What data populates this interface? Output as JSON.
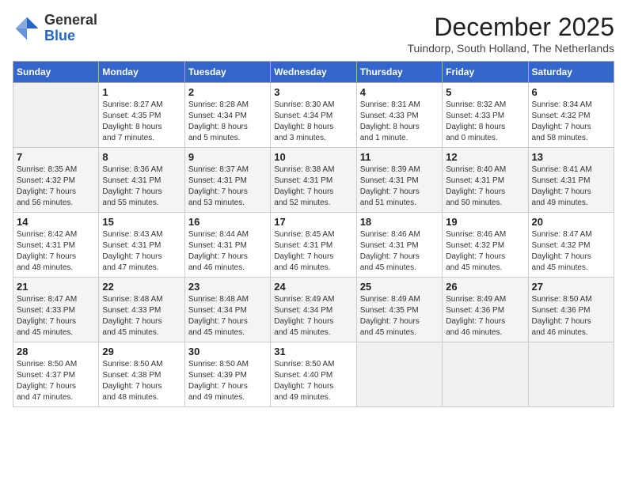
{
  "header": {
    "logo_general": "General",
    "logo_blue": "Blue",
    "month_year": "December 2025",
    "location": "Tuindorp, South Holland, The Netherlands"
  },
  "weekdays": [
    "Sunday",
    "Monday",
    "Tuesday",
    "Wednesday",
    "Thursday",
    "Friday",
    "Saturday"
  ],
  "weeks": [
    [
      {
        "day": "",
        "info": ""
      },
      {
        "day": "1",
        "info": "Sunrise: 8:27 AM\nSunset: 4:35 PM\nDaylight: 8 hours\nand 7 minutes."
      },
      {
        "day": "2",
        "info": "Sunrise: 8:28 AM\nSunset: 4:34 PM\nDaylight: 8 hours\nand 5 minutes."
      },
      {
        "day": "3",
        "info": "Sunrise: 8:30 AM\nSunset: 4:34 PM\nDaylight: 8 hours\nand 3 minutes."
      },
      {
        "day": "4",
        "info": "Sunrise: 8:31 AM\nSunset: 4:33 PM\nDaylight: 8 hours\nand 1 minute."
      },
      {
        "day": "5",
        "info": "Sunrise: 8:32 AM\nSunset: 4:33 PM\nDaylight: 8 hours\nand 0 minutes."
      },
      {
        "day": "6",
        "info": "Sunrise: 8:34 AM\nSunset: 4:32 PM\nDaylight: 7 hours\nand 58 minutes."
      }
    ],
    [
      {
        "day": "7",
        "info": "Sunrise: 8:35 AM\nSunset: 4:32 PM\nDaylight: 7 hours\nand 56 minutes."
      },
      {
        "day": "8",
        "info": "Sunrise: 8:36 AM\nSunset: 4:31 PM\nDaylight: 7 hours\nand 55 minutes."
      },
      {
        "day": "9",
        "info": "Sunrise: 8:37 AM\nSunset: 4:31 PM\nDaylight: 7 hours\nand 53 minutes."
      },
      {
        "day": "10",
        "info": "Sunrise: 8:38 AM\nSunset: 4:31 PM\nDaylight: 7 hours\nand 52 minutes."
      },
      {
        "day": "11",
        "info": "Sunrise: 8:39 AM\nSunset: 4:31 PM\nDaylight: 7 hours\nand 51 minutes."
      },
      {
        "day": "12",
        "info": "Sunrise: 8:40 AM\nSunset: 4:31 PM\nDaylight: 7 hours\nand 50 minutes."
      },
      {
        "day": "13",
        "info": "Sunrise: 8:41 AM\nSunset: 4:31 PM\nDaylight: 7 hours\nand 49 minutes."
      }
    ],
    [
      {
        "day": "14",
        "info": "Sunrise: 8:42 AM\nSunset: 4:31 PM\nDaylight: 7 hours\nand 48 minutes."
      },
      {
        "day": "15",
        "info": "Sunrise: 8:43 AM\nSunset: 4:31 PM\nDaylight: 7 hours\nand 47 minutes."
      },
      {
        "day": "16",
        "info": "Sunrise: 8:44 AM\nSunset: 4:31 PM\nDaylight: 7 hours\nand 46 minutes."
      },
      {
        "day": "17",
        "info": "Sunrise: 8:45 AM\nSunset: 4:31 PM\nDaylight: 7 hours\nand 46 minutes."
      },
      {
        "day": "18",
        "info": "Sunrise: 8:46 AM\nSunset: 4:31 PM\nDaylight: 7 hours\nand 45 minutes."
      },
      {
        "day": "19",
        "info": "Sunrise: 8:46 AM\nSunset: 4:32 PM\nDaylight: 7 hours\nand 45 minutes."
      },
      {
        "day": "20",
        "info": "Sunrise: 8:47 AM\nSunset: 4:32 PM\nDaylight: 7 hours\nand 45 minutes."
      }
    ],
    [
      {
        "day": "21",
        "info": "Sunrise: 8:47 AM\nSunset: 4:33 PM\nDaylight: 7 hours\nand 45 minutes."
      },
      {
        "day": "22",
        "info": "Sunrise: 8:48 AM\nSunset: 4:33 PM\nDaylight: 7 hours\nand 45 minutes."
      },
      {
        "day": "23",
        "info": "Sunrise: 8:48 AM\nSunset: 4:34 PM\nDaylight: 7 hours\nand 45 minutes."
      },
      {
        "day": "24",
        "info": "Sunrise: 8:49 AM\nSunset: 4:34 PM\nDaylight: 7 hours\nand 45 minutes."
      },
      {
        "day": "25",
        "info": "Sunrise: 8:49 AM\nSunset: 4:35 PM\nDaylight: 7 hours\nand 45 minutes."
      },
      {
        "day": "26",
        "info": "Sunrise: 8:49 AM\nSunset: 4:36 PM\nDaylight: 7 hours\nand 46 minutes."
      },
      {
        "day": "27",
        "info": "Sunrise: 8:50 AM\nSunset: 4:36 PM\nDaylight: 7 hours\nand 46 minutes."
      }
    ],
    [
      {
        "day": "28",
        "info": "Sunrise: 8:50 AM\nSunset: 4:37 PM\nDaylight: 7 hours\nand 47 minutes."
      },
      {
        "day": "29",
        "info": "Sunrise: 8:50 AM\nSunset: 4:38 PM\nDaylight: 7 hours\nand 48 minutes."
      },
      {
        "day": "30",
        "info": "Sunrise: 8:50 AM\nSunset: 4:39 PM\nDaylight: 7 hours\nand 49 minutes."
      },
      {
        "day": "31",
        "info": "Sunrise: 8:50 AM\nSunset: 4:40 PM\nDaylight: 7 hours\nand 49 minutes."
      },
      {
        "day": "",
        "info": ""
      },
      {
        "day": "",
        "info": ""
      },
      {
        "day": "",
        "info": ""
      }
    ]
  ]
}
